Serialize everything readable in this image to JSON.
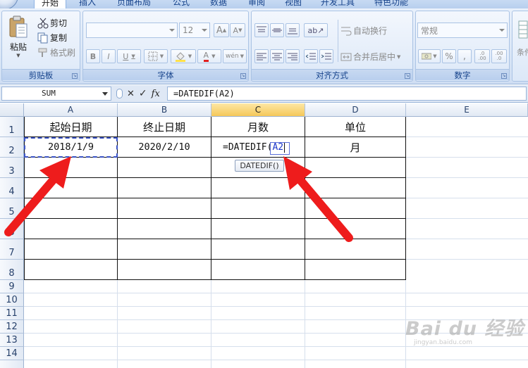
{
  "ribbon": {
    "tabs": [
      "开始",
      "插入",
      "页面布局",
      "公式",
      "数据",
      "审阅",
      "视图",
      "开发工具",
      "特色功能"
    ],
    "clipboard": {
      "paste": "粘贴",
      "cut": "剪切",
      "copy": "复制",
      "format_painter": "格式刷",
      "label": "剪贴板"
    },
    "font": {
      "font_size": "12",
      "grow": "A",
      "shrink": "A",
      "bold": "B",
      "italic": "I",
      "underline": "U",
      "font_color": "A",
      "wen": "wén",
      "label": "字体"
    },
    "alignment": {
      "wrap_text": "自动换行",
      "merge_center": "合并后居中",
      "label": "对齐方式"
    },
    "number": {
      "format": "常规",
      "percent": "%",
      "comma": ",",
      "inc_decimal": ".0 .00",
      "dec_decimal": ".00 .0",
      "label": "数字"
    },
    "styles": {
      "label": "条件"
    }
  },
  "formula_bar": {
    "name_box": "SUM",
    "cancel": "✕",
    "enter": "✓",
    "fx": "fx",
    "formula": "=DATEDIF(A2)"
  },
  "sheet": {
    "columns": [
      "A",
      "B",
      "C",
      "D",
      "E"
    ],
    "rows": [
      "1",
      "2",
      "3",
      "4",
      "5",
      "6",
      "7",
      "8",
      "9",
      "10",
      "11",
      "12",
      "13",
      "14"
    ],
    "cells": {
      "A1": "起始日期",
      "B1": "终止日期",
      "C1": "月数",
      "D1": "单位",
      "A2": "2018/1/9",
      "B2": "2020/2/10",
      "C2_prefix": "=DATEDIF(",
      "C2_ref": "A2",
      "D2": "月"
    },
    "tooltip": "DATEDIF()"
  },
  "watermark": {
    "logo": "Bai du 经验",
    "url": "jingyan.baidu.com"
  },
  "colors": {
    "arrow": "#ee1c1c",
    "ref_blue": "#1b36c9",
    "selected_col": "#f5c85a"
  }
}
